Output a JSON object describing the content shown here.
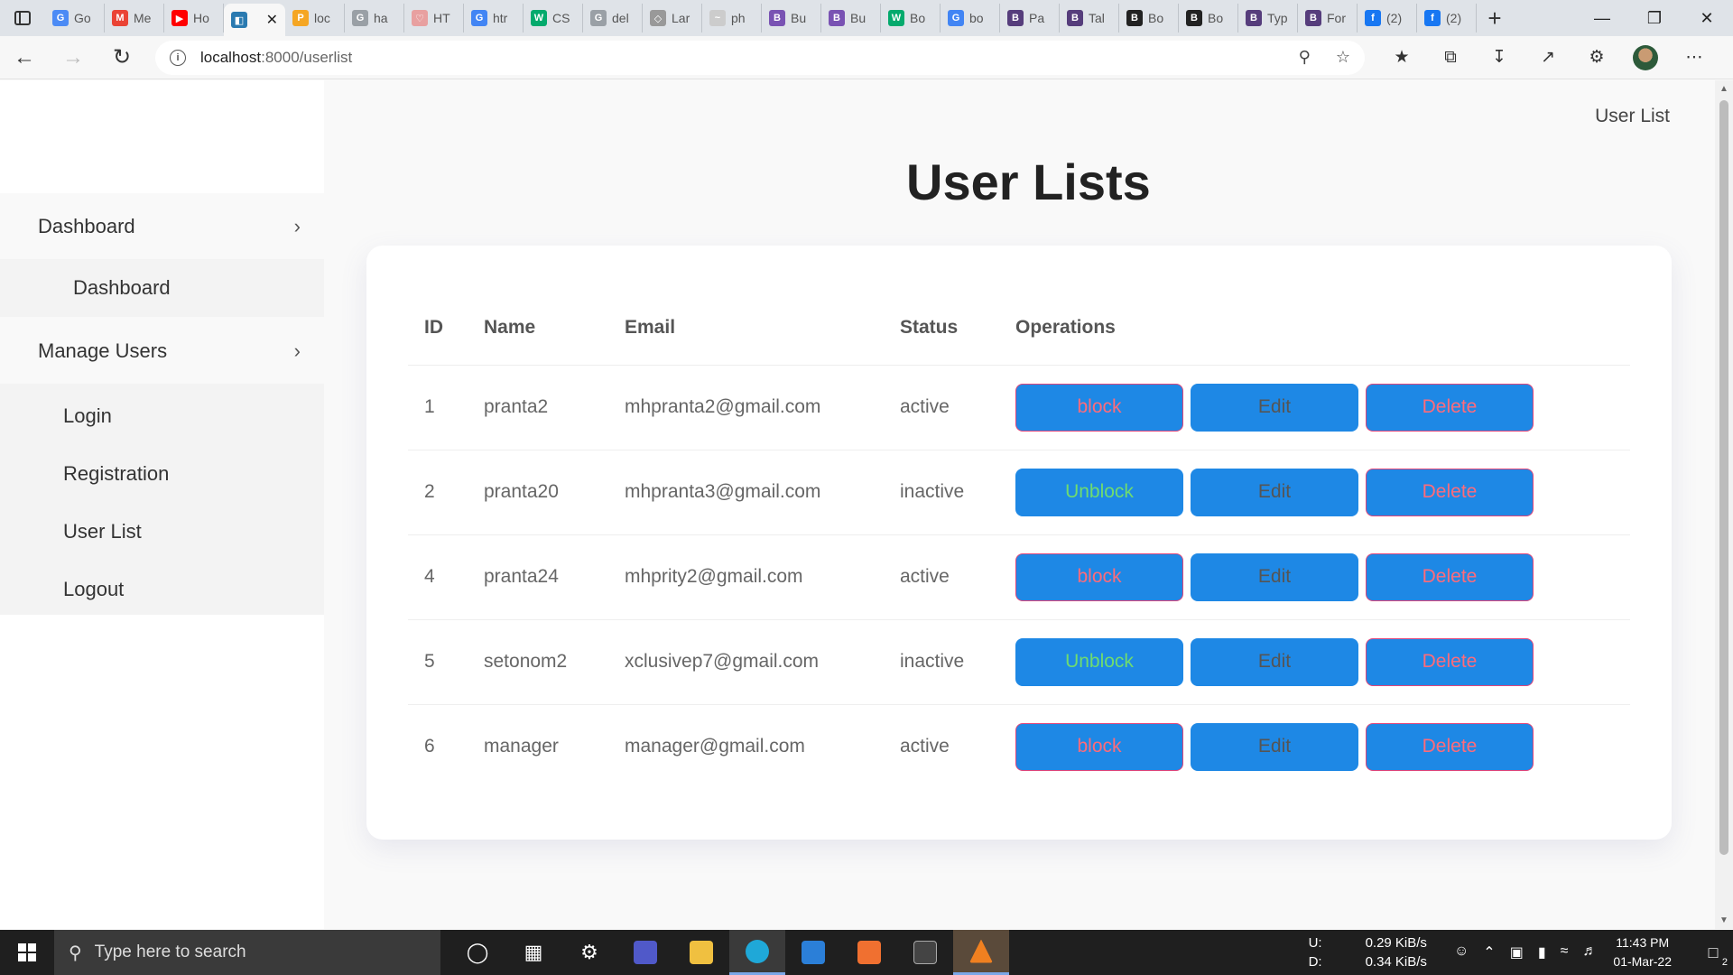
{
  "browser": {
    "tabs": [
      {
        "label": "Go",
        "fav_color": "#4c8bf5",
        "fav_text": "G"
      },
      {
        "label": "Me",
        "fav_color": "#ea4335",
        "fav_text": "M"
      },
      {
        "label": "Ho",
        "fav_color": "#ff0000",
        "fav_text": "▶"
      },
      {
        "label": "",
        "fav_color": "#2a7ab0",
        "fav_text": "◧",
        "active": true
      },
      {
        "label": "loc",
        "fav_color": "#f5a623",
        "fav_text": "P"
      },
      {
        "label": "ha",
        "fav_color": "#9aa0a6",
        "fav_text": "G"
      },
      {
        "label": "HT",
        "fav_color": "#e8a0a0",
        "fav_text": "♡"
      },
      {
        "label": "htr",
        "fav_color": "#4285f4",
        "fav_text": "G"
      },
      {
        "label": "CS",
        "fav_color": "#04aa6d",
        "fav_text": "W"
      },
      {
        "label": "del",
        "fav_color": "#9aa0a6",
        "fav_text": "G"
      },
      {
        "label": "Lar",
        "fav_color": "#999999",
        "fav_text": "◇"
      },
      {
        "label": "ph",
        "fav_color": "#cccccc",
        "fav_text": "~"
      },
      {
        "label": "Bu",
        "fav_color": "#7952b3",
        "fav_text": "B"
      },
      {
        "label": "Bu",
        "fav_color": "#7952b3",
        "fav_text": "B"
      },
      {
        "label": "Bo",
        "fav_color": "#04aa6d",
        "fav_text": "W"
      },
      {
        "label": "bo",
        "fav_color": "#4285f4",
        "fav_text": "G"
      },
      {
        "label": "Pa",
        "fav_color": "#563d7c",
        "fav_text": "B"
      },
      {
        "label": "Tal",
        "fav_color": "#563d7c",
        "fav_text": "B"
      },
      {
        "label": "Bo",
        "fav_color": "#222222",
        "fav_text": "B"
      },
      {
        "label": "Bo",
        "fav_color": "#222222",
        "fav_text": "B"
      },
      {
        "label": "Typ",
        "fav_color": "#563d7c",
        "fav_text": "B"
      },
      {
        "label": "For",
        "fav_color": "#563d7c",
        "fav_text": "B"
      },
      {
        "label": "(2)",
        "fav_color": "#1877f2",
        "fav_text": "f"
      },
      {
        "label": "(2)",
        "fav_color": "#1877f2",
        "fav_text": "f"
      }
    ],
    "url_host": "localhost",
    "url_path": ":8000/userlist"
  },
  "page": {
    "nav_link": "User List",
    "title": "User Lists"
  },
  "sidebar": {
    "dashboard_group": "Dashboard",
    "dashboard_sub": "Dashboard",
    "manage_group": "Manage Users",
    "manage_items": [
      "Login",
      "Registration",
      "User List",
      "Logout"
    ]
  },
  "table": {
    "headers": [
      "ID",
      "Name",
      "Email",
      "Status",
      "Operations"
    ],
    "rows": [
      {
        "id": "1",
        "name": "pranta2",
        "email": "mhpranta2@gmail.com",
        "status": "active",
        "action": "block"
      },
      {
        "id": "2",
        "name": "pranta20",
        "email": "mhpranta3@gmail.com",
        "status": "inactive",
        "action": "Unblock"
      },
      {
        "id": "4",
        "name": "pranta24",
        "email": "mhprity2@gmail.com",
        "status": "active",
        "action": "block"
      },
      {
        "id": "5",
        "name": "setonom2",
        "email": "xclusivep7@gmail.com",
        "status": "inactive",
        "action": "Unblock"
      },
      {
        "id": "6",
        "name": "manager",
        "email": "manager@gmail.com",
        "status": "active",
        "action": "block"
      }
    ],
    "edit_label": "Edit",
    "delete_label": "Delete"
  },
  "taskbar": {
    "search_placeholder": "Type here to search",
    "net_up_label": "U:",
    "net_down_label": "D:",
    "net_up": "0.29 KiB/s",
    "net_down": "0.34 KiB/s",
    "time": "11:43 PM",
    "date": "01-Mar-22",
    "notif_count": "2"
  }
}
